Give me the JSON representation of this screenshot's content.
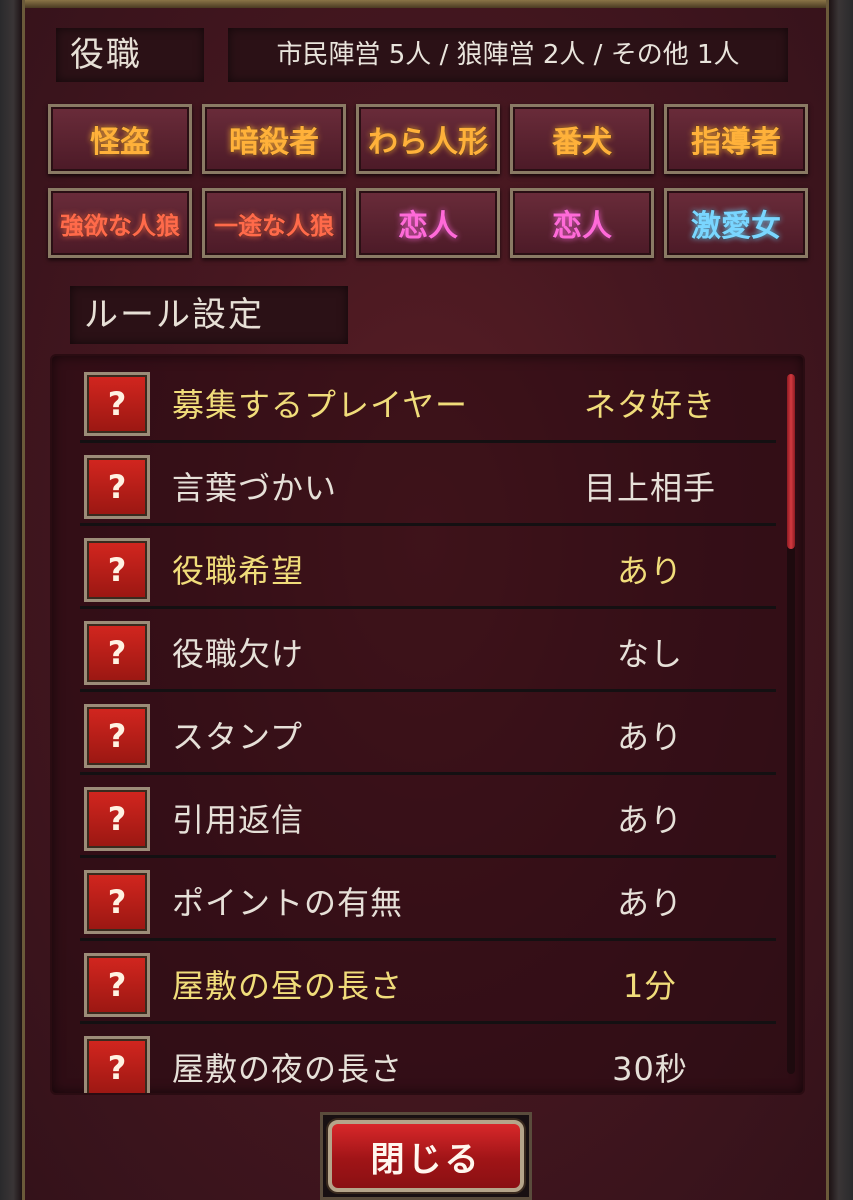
{
  "roles_section": {
    "title": "役職",
    "counts": "市民陣営 5人 / 狼陣営 2人 / その他 1人",
    "roles": [
      {
        "label": "怪盗",
        "color": "#ffb13a"
      },
      {
        "label": "暗殺者",
        "color": "#ffb13a"
      },
      {
        "label": "わら人形",
        "color": "#ffb13a"
      },
      {
        "label": "番犬",
        "color": "#ffb13a"
      },
      {
        "label": "指導者",
        "color": "#ffb13a"
      },
      {
        "label": "強欲な人狼",
        "color": "#ff6a4a"
      },
      {
        "label": "一途な人狼",
        "color": "#ff6a4a"
      },
      {
        "label": "恋人",
        "color": "#ff6ad8"
      },
      {
        "label": "恋人",
        "color": "#ff6ad8"
      },
      {
        "label": "激愛女",
        "color": "#7ad6ff"
      }
    ]
  },
  "rules_section": {
    "title": "ルール設定",
    "help_icon_glyph": "?",
    "rules": [
      {
        "label": "募集するプレイヤー",
        "value": "ネタ好き",
        "highlight": true
      },
      {
        "label": "言葉づかい",
        "value": "目上相手",
        "highlight": false
      },
      {
        "label": "役職希望",
        "value": "あり",
        "highlight": true
      },
      {
        "label": "役職欠け",
        "value": "なし",
        "highlight": false
      },
      {
        "label": "スタンプ",
        "value": "あり",
        "highlight": false
      },
      {
        "label": "引用返信",
        "value": "あり",
        "highlight": false
      },
      {
        "label": "ポイントの有無",
        "value": "あり",
        "highlight": false
      },
      {
        "label": "屋敷の昼の長さ",
        "value": "1分",
        "highlight": true
      },
      {
        "label": "屋敷の夜の長さ",
        "value": "30秒",
        "highlight": false
      }
    ]
  },
  "close_button": {
    "label": "閉じる"
  }
}
